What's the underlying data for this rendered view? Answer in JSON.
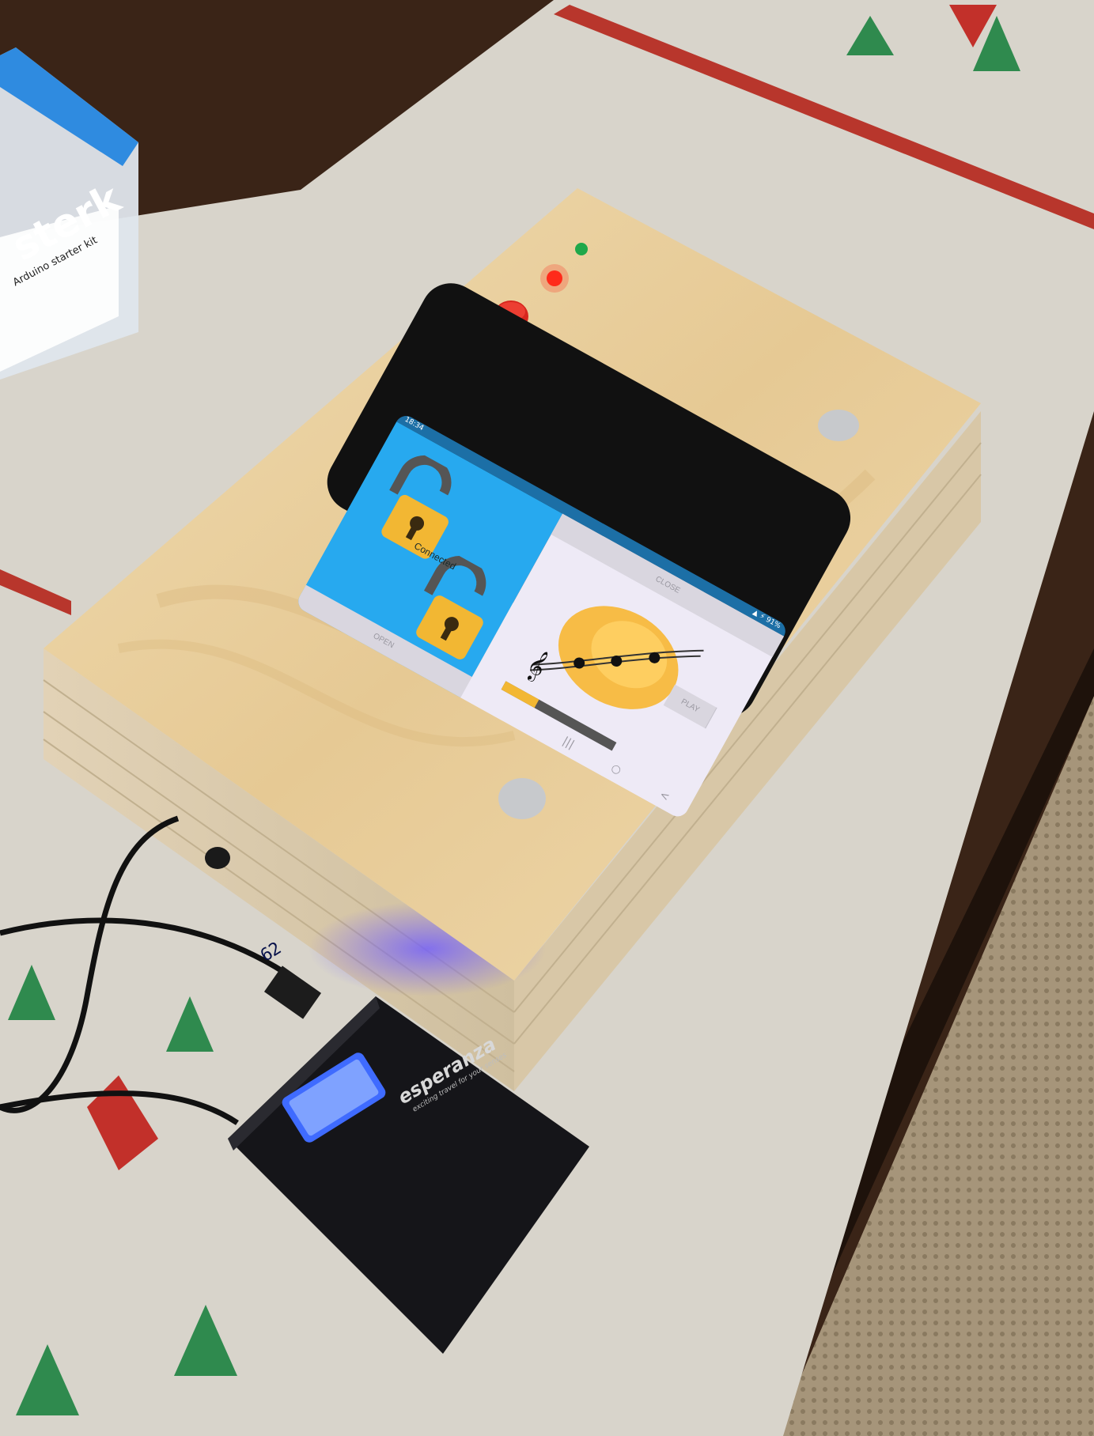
{
  "photo": {
    "subject": "wooden box with phone, LEDs and power bank",
    "colors": {
      "wood": "#e8cfa2",
      "table": "#3a2417",
      "runner": "#d8d4cb",
      "runner_stripe": "#b8362c",
      "phone_bezel": "#111111",
      "app_blue": "#27a9ef",
      "app_light": "#eeeaf6",
      "lock_gold": "#f2b733",
      "led_red": "#ff2a1a",
      "led_green": "#1fa84a",
      "button_red": "#d7261e",
      "lcd_blue": "#3f6bff",
      "powerbank": "#151519"
    }
  },
  "phone": {
    "status_time": "18:34",
    "status_icons": "▲ ⚡ 91%",
    "app": {
      "status_label": "Connected",
      "open_button": "OPEN",
      "close_button": "CLOSE",
      "play_button": "PLAY",
      "icons": [
        "unlocked-padlock-icon",
        "unlocked-padlock-icon",
        "music-notes-icon"
      ],
      "volume_level": 0.3
    },
    "nav": {
      "recent": "|||",
      "home": "○",
      "back": "<"
    }
  },
  "powerbank": {
    "display": "62",
    "brand": "esperanza",
    "tagline": "exciting travel for your senses"
  },
  "storage_box": {
    "label": "sterk",
    "sub_label": "Arduino starter kit"
  }
}
